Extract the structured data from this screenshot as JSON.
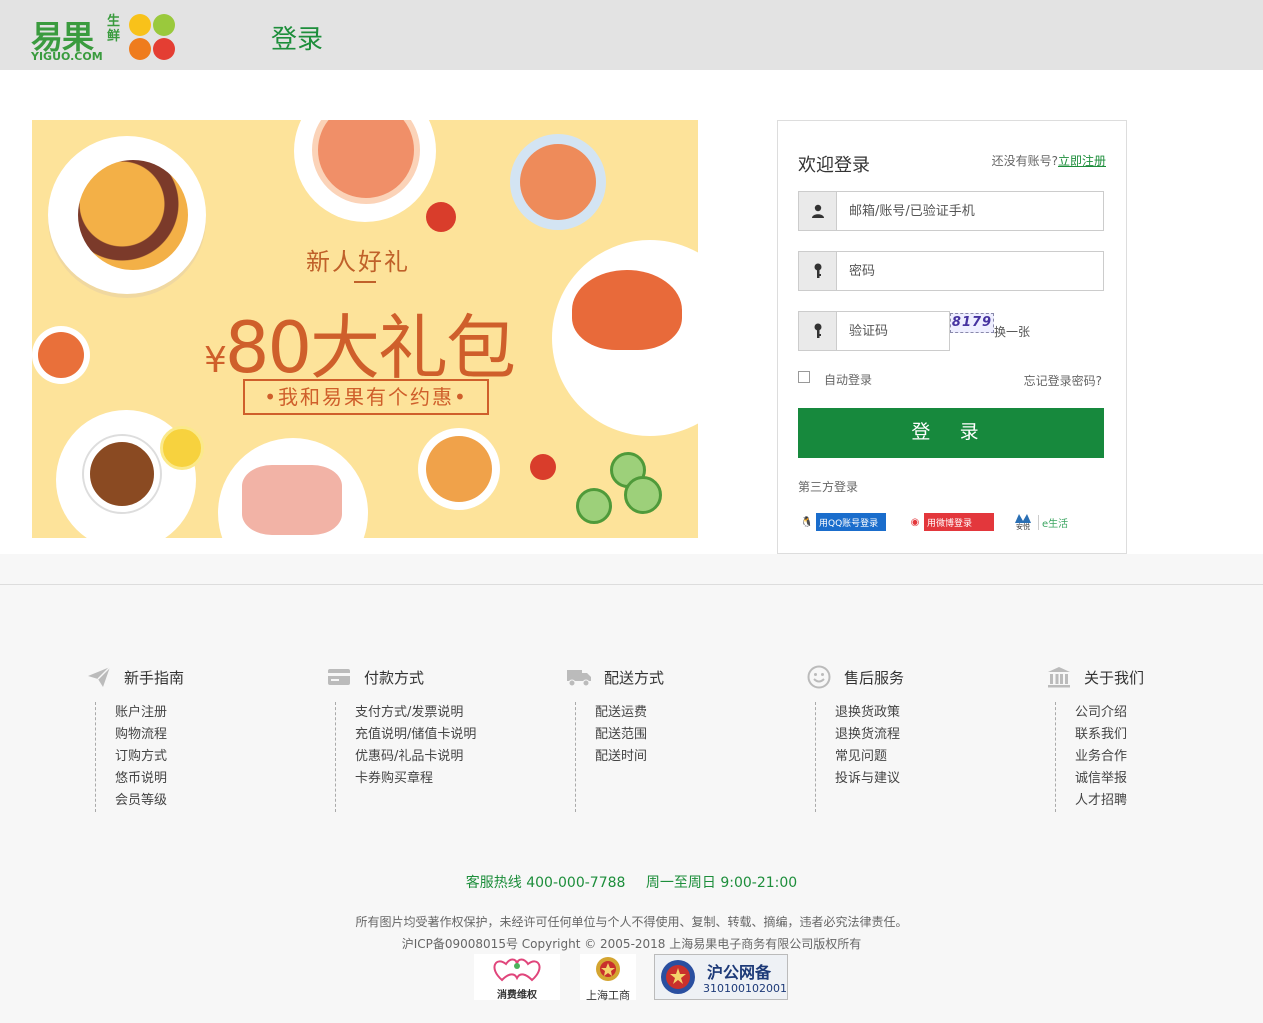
{
  "header": {
    "logo_cn": "易果",
    "logo_sub": "生鲜",
    "logo_en": "YIGUO.COM",
    "title": "登录",
    "logo_colors": [
      "#f8c21a",
      "#9ac93c",
      "#ef7c1d",
      "#e43e33"
    ]
  },
  "banner": {
    "subtitle": "新人好礼",
    "yen": "¥",
    "amount": "80大礼包",
    "tagline": "•我和易果有个约惠•"
  },
  "login": {
    "title": "欢迎登录",
    "no_account_text": "还没有账号?",
    "register_link": "立即注册",
    "username_placeholder": "邮箱/账号/已验证手机",
    "password_placeholder": "密码",
    "captcha_placeholder": "验证码",
    "captcha_code": "8179",
    "captcha_refresh": "换一张",
    "auto_login": "自动登录",
    "forgot_password": "忘记登录密码?",
    "submit": "登 录",
    "third_party_label": "第三方登录",
    "qq_login": "用QQ账号登录",
    "weibo_login": "用微博登录",
    "anyue_label": "安悦",
    "elife_label": "e生活"
  },
  "footer": {
    "columns": [
      {
        "title": "新手指南",
        "icon": "paper-plane-icon",
        "items": [
          "账户注册",
          "购物流程",
          "订购方式",
          "悠币说明",
          "会员等级"
        ]
      },
      {
        "title": "付款方式",
        "icon": "credit-card-icon",
        "items": [
          "支付方式/发票说明",
          "充值说明/储值卡说明",
          "优惠码/礼品卡说明",
          "卡券购买章程"
        ]
      },
      {
        "title": "配送方式",
        "icon": "truck-icon",
        "items": [
          "配送运费",
          "配送范围",
          "配送时间"
        ]
      },
      {
        "title": "售后服务",
        "icon": "smile-icon",
        "items": [
          "退换货政策",
          "退换货流程",
          "常见问题",
          "投诉与建议"
        ]
      },
      {
        "title": "关于我们",
        "icon": "bank-icon",
        "items": [
          "公司介绍",
          "联系我们",
          "业务合作",
          "诚信举报",
          "人才招聘"
        ]
      }
    ],
    "hotline": "客服热线 400-000-7788",
    "hours": "周一至周日 9:00-21:00",
    "copyright_notice": "所有图片均受著作权保护，未经许可任何单位与个人不得使用、复制、转载、摘编，违者必究法律责任。",
    "icp": "沪ICP备09008015号 Copyright © 2005-2018 上海易果电子商务有限公司版权所有",
    "badges": {
      "consumer": "消费维权",
      "aic": "上海工商",
      "police_title": "沪公网备",
      "police_number": "310100102001"
    }
  }
}
